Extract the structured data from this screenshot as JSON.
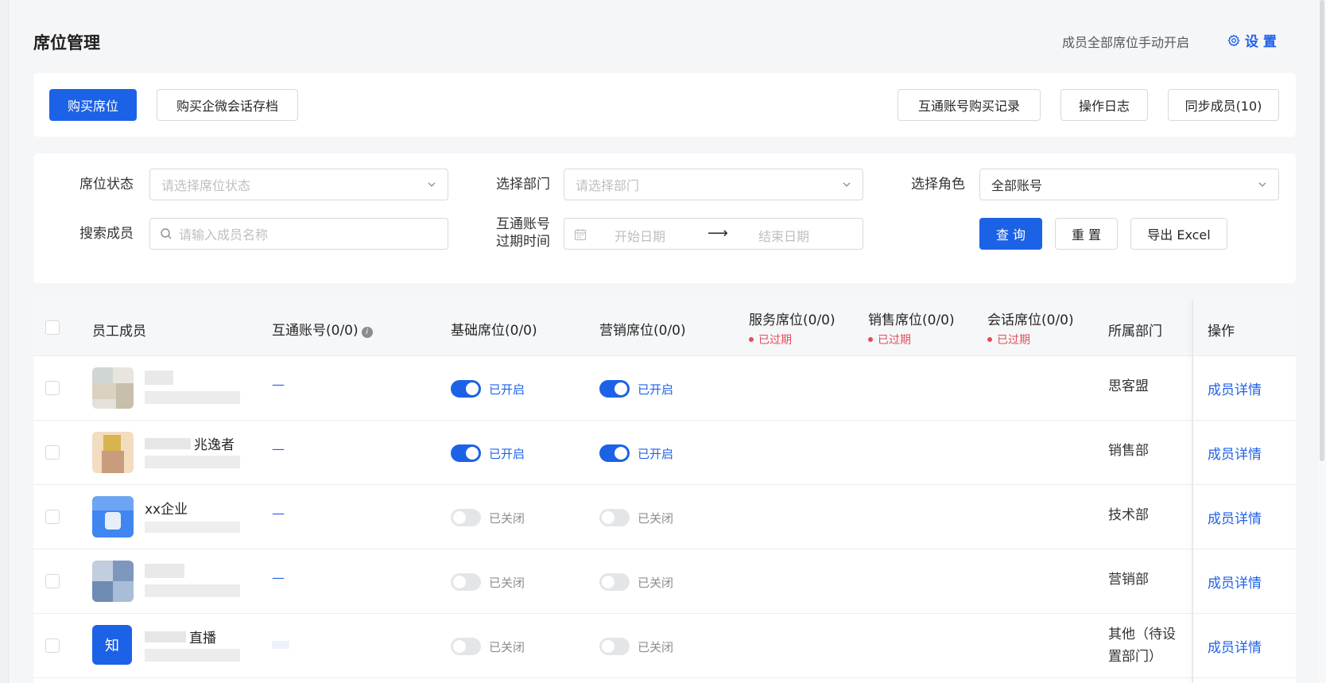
{
  "header": {
    "title": "席位管理",
    "note": "成员全部席位手动开启",
    "settings_label": "设 置"
  },
  "actions": {
    "buy_seat": "购买席位",
    "buy_archive": "购买企微会话存档",
    "purchase_records": "互通账号购买记录",
    "operation_log": "操作日志",
    "sync_members": "同步成员(10)"
  },
  "filters": {
    "seat_status_label": "席位状态",
    "seat_status_placeholder": "请选择席位状态",
    "dept_label": "选择部门",
    "dept_placeholder": "请选择部门",
    "role_label": "选择角色",
    "role_value": "全部账号",
    "search_label": "搜索成员",
    "search_placeholder": "请输入成员名称",
    "expire_label_line1": "互通账号",
    "expire_label_line2": "过期时间",
    "start_date_placeholder": "开始日期",
    "end_date_placeholder": "结束日期",
    "query": "查 询",
    "reset": "重 置",
    "export": "导出 Excel"
  },
  "table": {
    "columns": {
      "member": "员工成员",
      "interop_account": "互通账号(0/0)",
      "basic_seat": "基础席位(0/0)",
      "marketing_seat": "营销席位(0/0)",
      "service_seat": "服务席位(0/0)",
      "sales_seat": "销售席位(0/0)",
      "session_seat": "会话席位(0/0)",
      "department": "所属部门",
      "operation": "操作"
    },
    "expired_label": "已过期",
    "toggle_on_label": "已开启",
    "toggle_off_label": "已关闭",
    "detail_label": "成员详情",
    "rows": [
      {
        "name": "",
        "interop": "—",
        "basic": "已开启",
        "marketing": "已开启",
        "dept": "思客盟"
      },
      {
        "name": "兆逸者",
        "interop": "—",
        "basic": "已开启",
        "marketing": "已开启",
        "dept": "销售部"
      },
      {
        "name": "xx企业",
        "interop": "—",
        "basic": "已关闭",
        "marketing": "已关闭",
        "dept": "技术部"
      },
      {
        "name": "",
        "interop": "—",
        "basic": "已关闭",
        "marketing": "已关闭",
        "dept": "营销部"
      },
      {
        "name": "直播",
        "interop": "",
        "basic": "已关闭",
        "marketing": "已关闭",
        "dept_line1": "其他（待设",
        "dept_line2": "置部门）",
        "avatar_text": "知"
      }
    ]
  },
  "colors": {
    "primary": "#1c62e6",
    "link": "#2163e8",
    "expired": "#e34d59",
    "toggle_off": "#e3e5e8"
  }
}
